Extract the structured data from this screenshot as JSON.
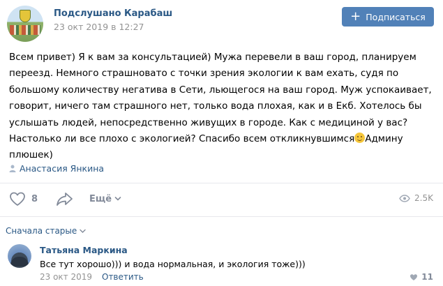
{
  "header": {
    "group_name": "Подслушано Карабаш",
    "post_date": "23 окт 2019 в 12:27",
    "subscribe_label": "Подписаться"
  },
  "post": {
    "text_before_emoji": "Всем привет) Я к вам за консультацией) Мужа перевели в ваш город, планируем переезд. Немного страшновато с точки зрения экологии к вам ехать, судя по большому количеству негатива в Сети, льющегося на ваш город. Муж успокаивает, говорит, ничего там страшного нет, только вода плохая, как и в Екб. Хотелось бы услышать людей, непосредственно живущих в городе. Как с медициной у вас? Настолько ли все плохо с экологией? Спасибо всем откликнувшимся",
    "text_after_emoji": "Админу плюшек)",
    "author": "Анастасия Янкина"
  },
  "actions": {
    "likes": "8",
    "more_label": "Ещё",
    "views": "2.5K"
  },
  "comments": {
    "sort_label": "Сначала старые",
    "items": [
      {
        "author": "Татьяна Маркина",
        "text": "Все тут хорошо))) и вода нормальная, и экология тоже)))",
        "date": "23 окт 2019",
        "reply_label": "Ответить",
        "likes": "11"
      }
    ]
  },
  "colors": {
    "link": "#2a5885",
    "accent_button": "#5181b8",
    "muted": "#939393",
    "icon": "#828a99"
  },
  "icons": [
    "heart-icon",
    "share-icon",
    "chevron-down-icon",
    "eye-icon",
    "user-icon",
    "smile-emoji-icon"
  ]
}
